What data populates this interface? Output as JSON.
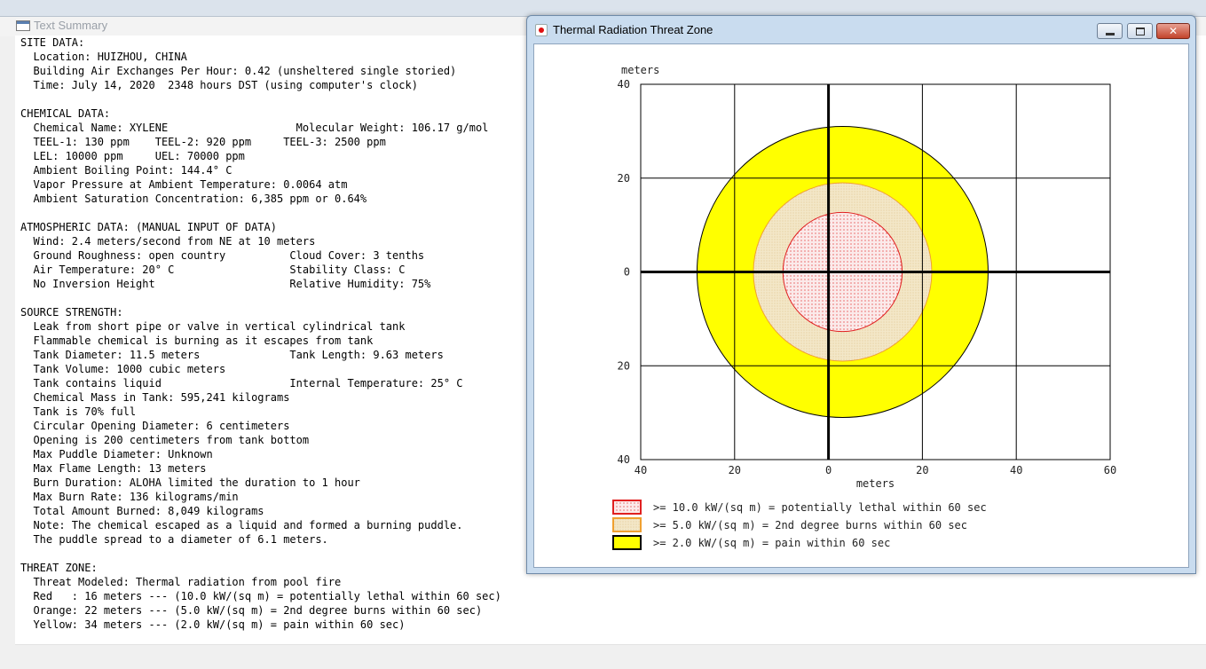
{
  "text_summary": {
    "title": "Text Summary",
    "lines": [
      "SITE DATA:",
      "  Location: HUIZHOU, CHINA",
      "  Building Air Exchanges Per Hour: 0.42 (unsheltered single storied)",
      "  Time: July 14, 2020  2348 hours DST (using computer's clock)",
      "",
      "CHEMICAL DATA:",
      "  Chemical Name: XYLENE                    Molecular Weight: 106.17 g/mol",
      "  TEEL-1: 130 ppm    TEEL-2: 920 ppm     TEEL-3: 2500 ppm",
      "  LEL: 10000 ppm     UEL: 70000 ppm",
      "  Ambient Boiling Point: 144.4° C",
      "  Vapor Pressure at Ambient Temperature: 0.0064 atm",
      "  Ambient Saturation Concentration: 6,385 ppm or 0.64%",
      "",
      "ATMOSPHERIC DATA: (MANUAL INPUT OF DATA)",
      "  Wind: 2.4 meters/second from NE at 10 meters",
      "  Ground Roughness: open country          Cloud Cover: 3 tenths",
      "  Air Temperature: 20° C                  Stability Class: C",
      "  No Inversion Height                     Relative Humidity: 75%",
      "",
      "SOURCE STRENGTH:",
      "  Leak from short pipe or valve in vertical cylindrical tank",
      "  Flammable chemical is burning as it escapes from tank",
      "  Tank Diameter: 11.5 meters              Tank Length: 9.63 meters",
      "  Tank Volume: 1000 cubic meters",
      "  Tank contains liquid                    Internal Temperature: 25° C",
      "  Chemical Mass in Tank: 595,241 kilograms",
      "  Tank is 70% full",
      "  Circular Opening Diameter: 6 centimeters",
      "  Opening is 200 centimeters from tank bottom",
      "  Max Puddle Diameter: Unknown",
      "  Max Flame Length: 13 meters",
      "  Burn Duration: ALOHA limited the duration to 1 hour",
      "  Max Burn Rate: 136 kilograms/min",
      "  Total Amount Burned: 8,049 kilograms",
      "  Note: The chemical escaped as a liquid and formed a burning puddle.",
      "  The puddle spread to a diameter of 6.1 meters.",
      "",
      "THREAT ZONE:",
      "  Threat Modeled: Thermal radiation from pool fire",
      "  Red   : 16 meters --- (10.0 kW/(sq m) = potentially lethal within 60 sec)",
      "  Orange: 22 meters --- (5.0 kW/(sq m) = 2nd degree burns within 60 sec)",
      "  Yellow: 34 meters --- (2.0 kW/(sq m) = pain within 60 sec)"
    ]
  },
  "thermal_window": {
    "title": "Thermal Radiation Threat Zone",
    "close_label": "✕"
  },
  "chart_data": {
    "type": "threat_zone_plot",
    "ylabel": "meters",
    "xlabel": "meters",
    "x_ticks": [
      "40",
      "20",
      "0",
      "20",
      "40",
      "60"
    ],
    "x_tick_values": [
      -40,
      -20,
      0,
      20,
      40,
      60
    ],
    "y_ticks": [
      "40",
      "20",
      "0",
      "20",
      "40"
    ],
    "y_tick_values": [
      40,
      20,
      0,
      -20,
      -40
    ],
    "xlim": [
      -40,
      60
    ],
    "ylim": [
      -40,
      40
    ],
    "grid": true,
    "zones": [
      {
        "name": "yellow",
        "center_x": 3,
        "center_y": 0,
        "radius": 31,
        "fill": "#ffff00",
        "stroke": "#000000"
      },
      {
        "name": "orange",
        "center_x": 3,
        "center_y": 0,
        "radius": 19,
        "fill": "#f3e7c8",
        "stroke": "#f0a030"
      },
      {
        "name": "red",
        "center_x": 3,
        "center_y": 0,
        "radius": 12.7,
        "fill": "#fbeaea",
        "stroke": "#e02020"
      }
    ],
    "legend": [
      {
        "label": ">= 10.0 kW/(sq m) = potentially lethal within 60 sec",
        "color": "#e02020",
        "fill": "#fbeaea"
      },
      {
        "label": ">= 5.0 kW/(sq m) = 2nd degree burns within 60 sec",
        "color": "#f0a030",
        "fill": "#f3e7c8"
      },
      {
        "label": ">= 2.0 kW/(sq m) = pain within 60 sec",
        "color": "#000000",
        "fill": "#ffff00"
      }
    ]
  }
}
